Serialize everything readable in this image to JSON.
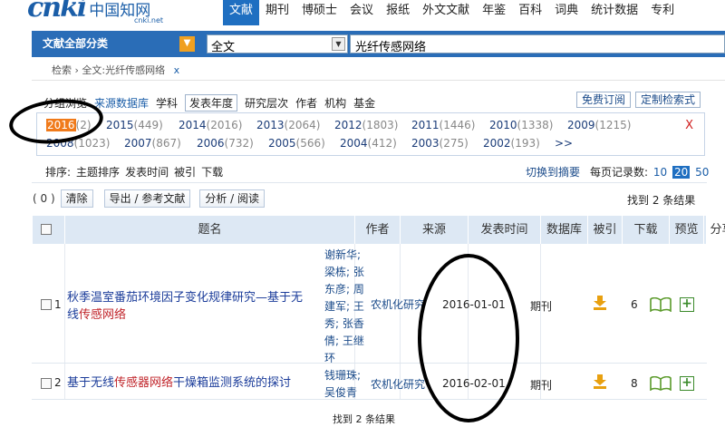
{
  "header": {
    "logo_mark": "cnki",
    "logo_cn": "中国知网",
    "logo_url": "cnki.net",
    "nav": [
      "文献",
      "期刊",
      "博硕士",
      "会议",
      "报纸",
      "外文文献",
      "年鉴",
      "百科",
      "词典",
      "统计数据",
      "专利"
    ],
    "active_nav": "文献"
  },
  "search": {
    "scope_label": "文献全部分类",
    "field": "全文",
    "query": "光纤传感网络"
  },
  "breadcrumb": {
    "root": "检索",
    "current": "全文:光纤传感网络",
    "remove": "x"
  },
  "grouping": {
    "tabs": [
      "分组浏览",
      "来源数据库",
      "学科",
      "发表年度",
      "研究层次",
      "作者",
      "机构",
      "基金"
    ],
    "selected_tab": "发表年度",
    "free_subscribe": "免费订阅",
    "custom_search": "定制检索式",
    "years_row1": [
      {
        "year": "2016",
        "count": "(2)",
        "selected": true
      },
      {
        "year": "2015",
        "count": "(449)"
      },
      {
        "year": "2014",
        "count": "(2016)"
      },
      {
        "year": "2013",
        "count": "(2064)"
      },
      {
        "year": "2012",
        "count": "(1803)"
      },
      {
        "year": "2011",
        "count": "(1446)"
      },
      {
        "year": "2010",
        "count": "(1338)"
      },
      {
        "year": "2009",
        "count": "(1215)"
      }
    ],
    "years_row2": [
      {
        "year": "2008",
        "count": "(1023)"
      },
      {
        "year": "2007",
        "count": "(867)"
      },
      {
        "year": "2006",
        "count": "(732)"
      },
      {
        "year": "2005",
        "count": "(566)"
      },
      {
        "year": "2004",
        "count": "(412)"
      },
      {
        "year": "2003",
        "count": "(275)"
      },
      {
        "year": "2002",
        "count": "(193)"
      }
    ],
    "more": ">>",
    "close": "X"
  },
  "sort": {
    "label": "排序:",
    "options": [
      "主题排序",
      "发表时间",
      "被引",
      "下载"
    ],
    "switch_view": "切换到摘要",
    "per_page_label": "每页记录数:",
    "per_page": [
      "10",
      "20",
      "50"
    ],
    "per_page_selected": "20"
  },
  "actions": {
    "selected_count": "( 0 )",
    "clear": "清除",
    "export": "导出 / 参考文献",
    "analyze": "分析 / 阅读",
    "found": "找到 2 条结果"
  },
  "table": {
    "columns": [
      "题名",
      "作者",
      "来源",
      "发表时间",
      "数据库",
      "被引",
      "下载",
      "预览",
      "分享"
    ],
    "rows": [
      {
        "num": "1",
        "title_line1": "秋季温室番茄环境因子变化规律研究—基于无",
        "title_line2_plain": "线",
        "title_line2_hl": "传感网络",
        "authors": [
          "谢新华;",
          "梁栋; 张",
          "东彦; 周",
          "建军; 王",
          "秀; 张香",
          "倩; 王继",
          "环"
        ],
        "source": "农机化研究",
        "date": "2016-01-01",
        "db": "期刊",
        "downloads": "6"
      },
      {
        "num": "2",
        "title_a": "基于无线",
        "title_b": "传感器",
        "title_c": "网络",
        "title_d": "干燥箱监测系统的探讨",
        "authors": [
          "钱珊珠;",
          "吴俊青"
        ],
        "source": "农机化研究",
        "date": "2016-02-01",
        "db": "期刊",
        "downloads": "8"
      }
    ]
  },
  "footer": {
    "found": "找到 2 条结果"
  },
  "colors": {
    "brand_blue": "#1f6fc1",
    "highlight_red": "#c0242a",
    "year_selected": "#f07a1a"
  }
}
